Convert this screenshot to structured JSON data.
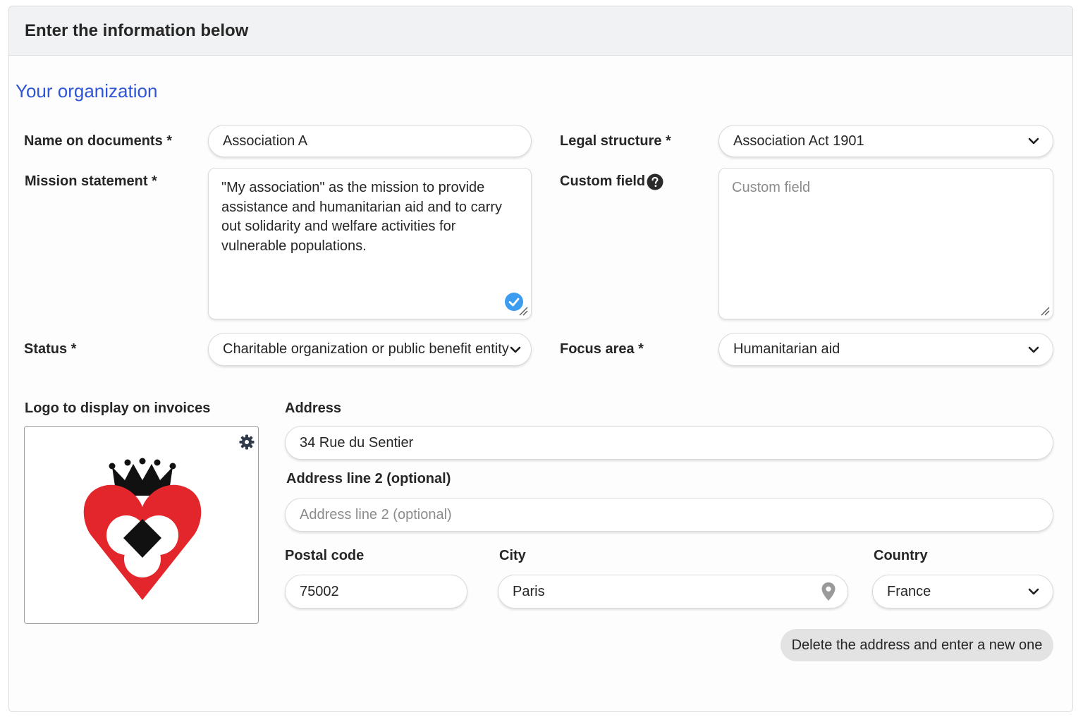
{
  "header": {
    "title": "Enter the information below"
  },
  "section": {
    "title": "Your organization"
  },
  "fields": {
    "name_on_documents": {
      "label": "Name on documents *",
      "value": "Association A"
    },
    "legal_structure": {
      "label": "Legal structure *",
      "value": "Association Act 1901"
    },
    "mission_statement": {
      "label": "Mission statement *",
      "value": "\"My association\" as the mission to provide assistance and humanitarian aid and to carry out solidarity and welfare activities for vulnerable populations."
    },
    "custom_field": {
      "label": "Custom field",
      "placeholder": "Custom field"
    },
    "status": {
      "label": "Status *",
      "value": "Charitable organization or public benefit entity"
    },
    "focus_area": {
      "label": "Focus area *",
      "value": "Humanitarian aid"
    },
    "logo": {
      "label": "Logo to display on invoices"
    },
    "address": {
      "label": "Address",
      "value": "34 Rue du Sentier"
    },
    "address_line2": {
      "label": "Address line 2 (optional)",
      "placeholder": "Address line 2 (optional)"
    },
    "postal_code": {
      "label": "Postal code",
      "value": "75002"
    },
    "city": {
      "label": "City",
      "value": "Paris"
    },
    "country": {
      "label": "Country",
      "value": "France"
    }
  },
  "actions": {
    "delete_address_label": "Delete the address and enter a new one"
  },
  "icons": {
    "help": "question-circle-icon",
    "check": "check-circle-icon",
    "gear": "gear-icon",
    "chevron": "chevron-down-icon",
    "pin": "map-pin-icon",
    "resize": "resize-handle-icon"
  },
  "colors": {
    "section_title": "#2d55d6",
    "check": "#3b9cf0",
    "logo_red": "#e3262b",
    "logo_black": "#111111",
    "button_bg": "#e3e3e3"
  }
}
